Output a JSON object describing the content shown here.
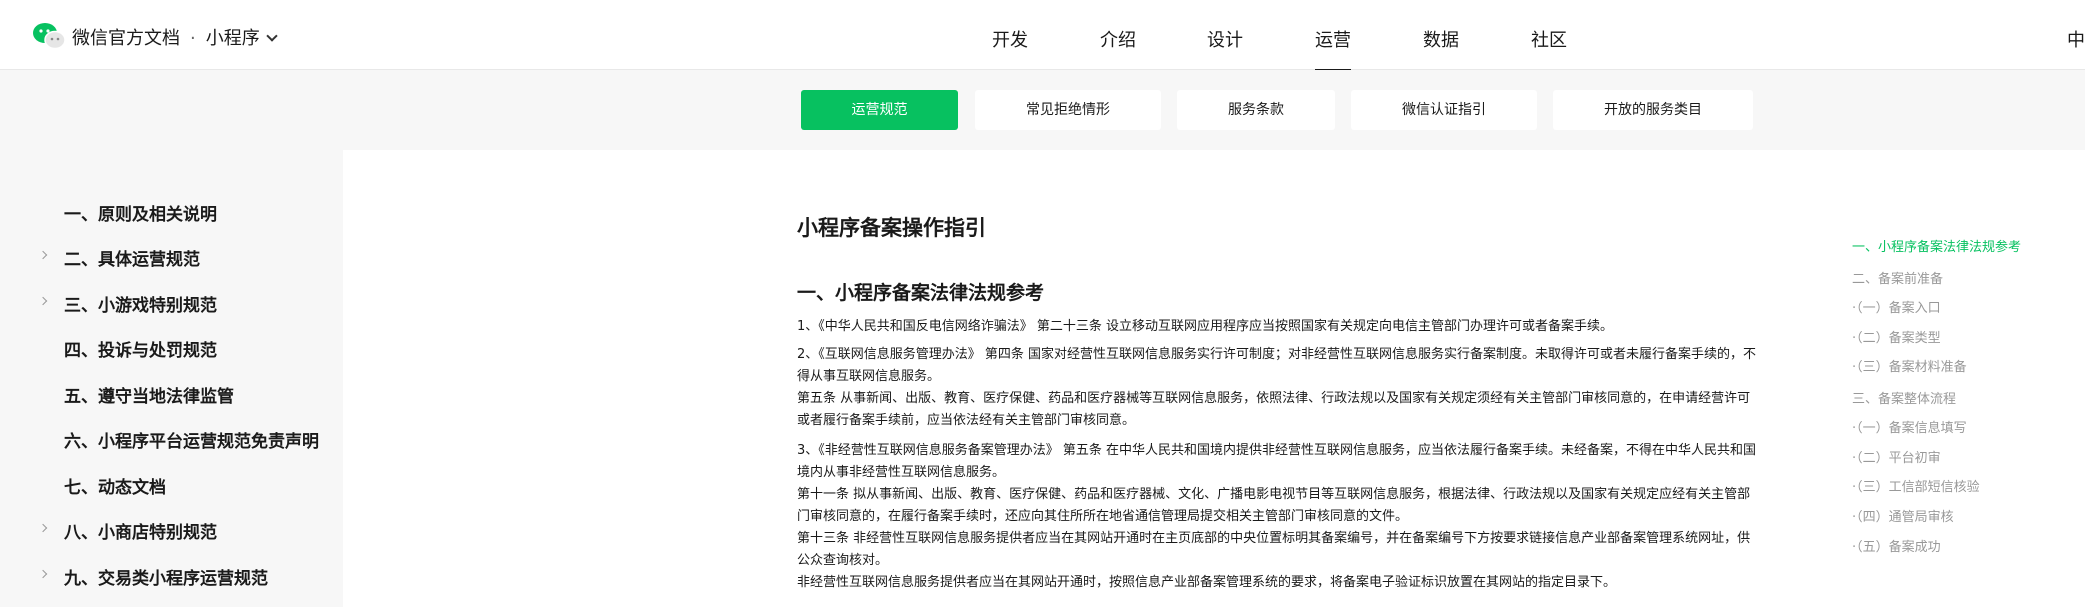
{
  "header": {
    "brand": "微信官方文档",
    "separator": "·",
    "product": "小程序",
    "nav": [
      "开发",
      "介绍",
      "设计",
      "运营",
      "数据",
      "社区"
    ],
    "active_nav": "运营",
    "lang": "中文"
  },
  "subnav": {
    "tabs": [
      "运营规范",
      "常见拒绝情形",
      "服务条款",
      "微信认证指引",
      "开放的服务类目"
    ],
    "active": "运营规范",
    "accent_color": "#07c160"
  },
  "sidebar": {
    "items": [
      {
        "label": "一、原则及相关说明",
        "expandable": false
      },
      {
        "label": "二、具体运营规范",
        "expandable": true
      },
      {
        "label": "三、小游戏特别规范",
        "expandable": true
      },
      {
        "label": "四、投诉与处罚规范",
        "expandable": false
      },
      {
        "label": "五、遵守当地法律监管",
        "expandable": false
      },
      {
        "label": "六、小程序平台运营规范免责声明",
        "expandable": false
      },
      {
        "label": "七、动态文档",
        "expandable": false
      },
      {
        "label": "八、小商店特别规范",
        "expandable": true
      },
      {
        "label": "九、交易类小程序运营规范",
        "expandable": true
      }
    ]
  },
  "main": {
    "title": "小程序备案操作指引",
    "section_title": "一、小程序备案法律法规参考",
    "paragraphs": [
      "1、《中华人民共和国反电信网络诈骗法》 第二十三条 设立移动互联网应用程序应当按照国家有关规定向电信主管部门办理许可或者备案手续。",
      "2、《互联网信息服务管理办法》 第四条 国家对经营性互联网信息服务实行许可制度；对非经营性互联网信息服务实行备案制度。未取得许可或者未履行备案手续的，不得从事互联网信息服务。",
      "第五条 从事新闻、出版、教育、医疗保健、药品和医疗器械等互联网信息服务，依照法律、行政法规以及国家有关规定须经有关主管部门审核同意的，在申请经营许可或者履行备案手续前，应当依法经有关主管部门审核同意。",
      "3、《非经营性互联网信息服务备案管理办法》 第五条 在中华人民共和国境内提供非经营性互联网信息服务，应当依法履行备案手续。未经备案，不得在中华人民共和国境内从事非经营性互联网信息服务。",
      "第十一条 拟从事新闻、出版、教育、医疗保健、药品和医疗器械、文化、广播电影电视节目等互联网信息服务，根据法律、行政法规以及国家有关规定应经有关主管部门审核同意的，在履行备案手续时，还应向其住所所在地省通信管理局提交相关主管部门审核同意的文件。",
      "第十三条 非经营性互联网信息服务提供者应当在其网站开通时在主页底部的中央位置标明其备案编号，并在备案编号下方按要求链接信息产业部备案管理系统网址，供公众查询核对。",
      "非经营性互联网信息服务提供者应当在其网站开通时，按照信息产业部备案管理系统的要求，将备案电子验证标识放置在其网站的指定目录下。"
    ]
  },
  "toc": {
    "items": [
      {
        "label": "一、小程序备案法律法规参考",
        "active": true
      },
      {
        "label": "二、备案前准备",
        "active": false
      },
      {
        "label": "·（一）备案入口",
        "active": false
      },
      {
        "label": "·（二）备案类型",
        "active": false
      },
      {
        "label": "·（三）备案材料准备",
        "active": false
      },
      {
        "label": "三、备案整体流程",
        "active": false
      },
      {
        "label": "·（一）备案信息填写",
        "active": false
      },
      {
        "label": "·（二）平台初审",
        "active": false
      },
      {
        "label": "·（三）工信部短信核验",
        "active": false
      },
      {
        "label": "·（四）通管局审核",
        "active": false
      },
      {
        "label": "·（五）备案成功",
        "active": false
      }
    ]
  }
}
